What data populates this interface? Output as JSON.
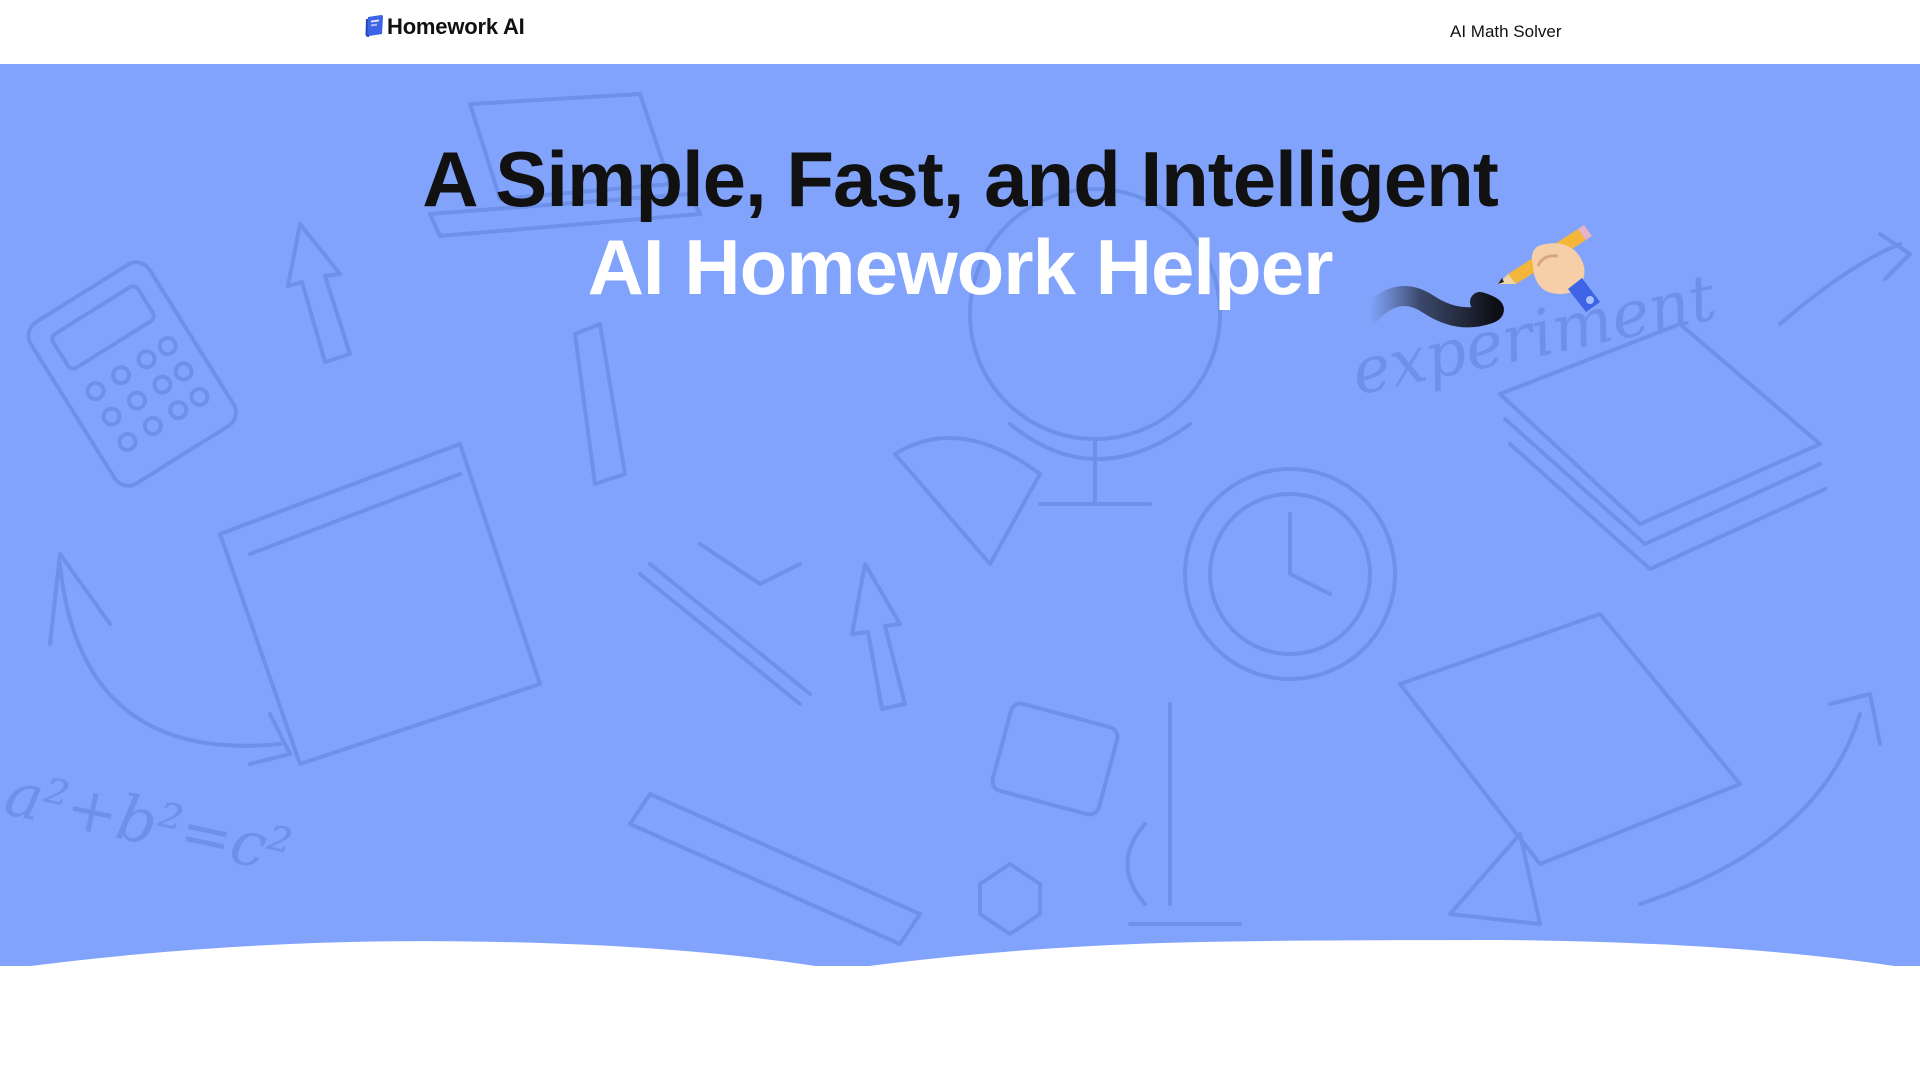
{
  "header": {
    "logo_text": "Homework AI",
    "logo_icon": "book-icon",
    "nav_link_label": "AI Math Solver"
  },
  "hero": {
    "title_line_1": "A Simple, Fast, and Intelligent",
    "title_line_2": "AI Homework Helper",
    "background_color": "#81a3fc",
    "decoration_icons": [
      "pencil-hand-icon",
      "brush-stroke-icon"
    ],
    "background_doodle_text": [
      "a²+b²=c²",
      "experiment"
    ]
  },
  "colors": {
    "brand_blue": "#3d63e6",
    "hero_blue": "#81a3fc",
    "heading_dark": "#111111",
    "heading_light": "#ffffff"
  }
}
